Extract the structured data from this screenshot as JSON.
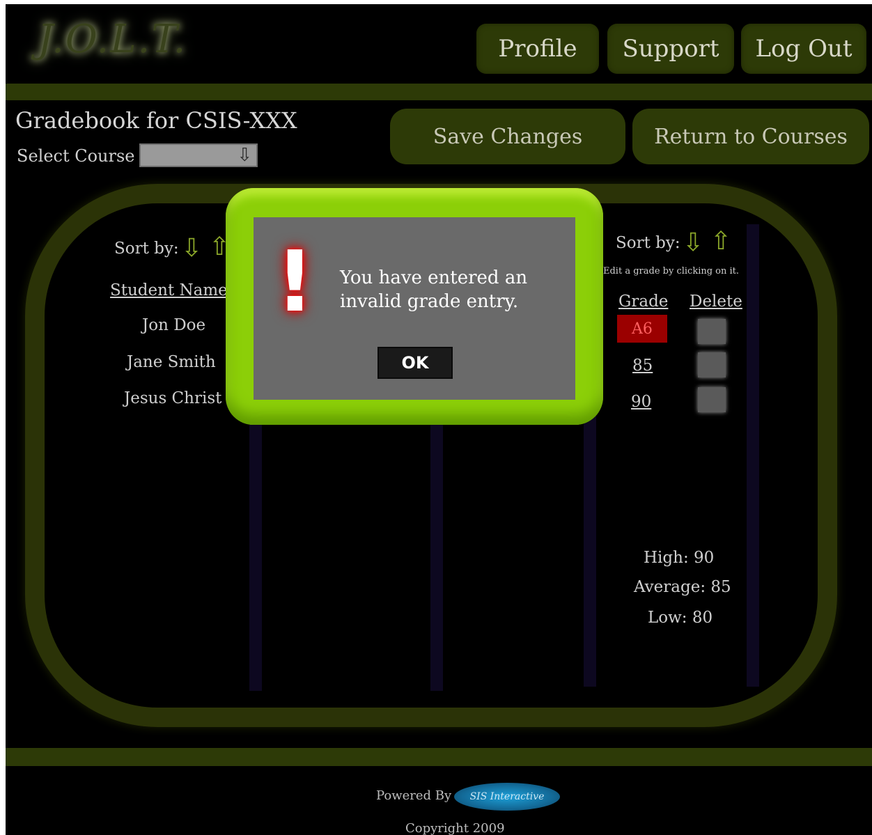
{
  "header": {
    "logo": "J.O.L.T.",
    "nav": {
      "profile": "Profile",
      "support": "Support",
      "logout": "Log Out"
    }
  },
  "page": {
    "title": "Gradebook for CSIS-XXX",
    "select_label": "Select Course",
    "select_arrow": "⇩",
    "save_label": "Save Changes",
    "return_label": "Return to Courses"
  },
  "left_panel": {
    "sort_label": "Sort by:",
    "column_header": "Student Name",
    "students": [
      "Jon Doe",
      "Jane Smith",
      "Jesus Christ"
    ]
  },
  "right_panel": {
    "sort_label": "Sort by:",
    "hint": "Edit a grade by clicking on it.",
    "grade_header": "Grade",
    "delete_header": "Delete",
    "grades": [
      "A6",
      "85",
      "90"
    ],
    "stats": {
      "high": "High: 90",
      "average": "Average: 85",
      "low": "Low: 80"
    }
  },
  "dialog": {
    "icon": "!",
    "message_line1": "You have entered an",
    "message_line2": "invalid grade entry.",
    "ok_label": "OK"
  },
  "footer": {
    "powered_by": "Powered By",
    "brand": "SIS Interactive",
    "copyright": "Copyright 2009"
  },
  "colors": {
    "accent": "#2d3a07",
    "dialog_frame": "#8ccf08",
    "error": "#9b0000"
  }
}
